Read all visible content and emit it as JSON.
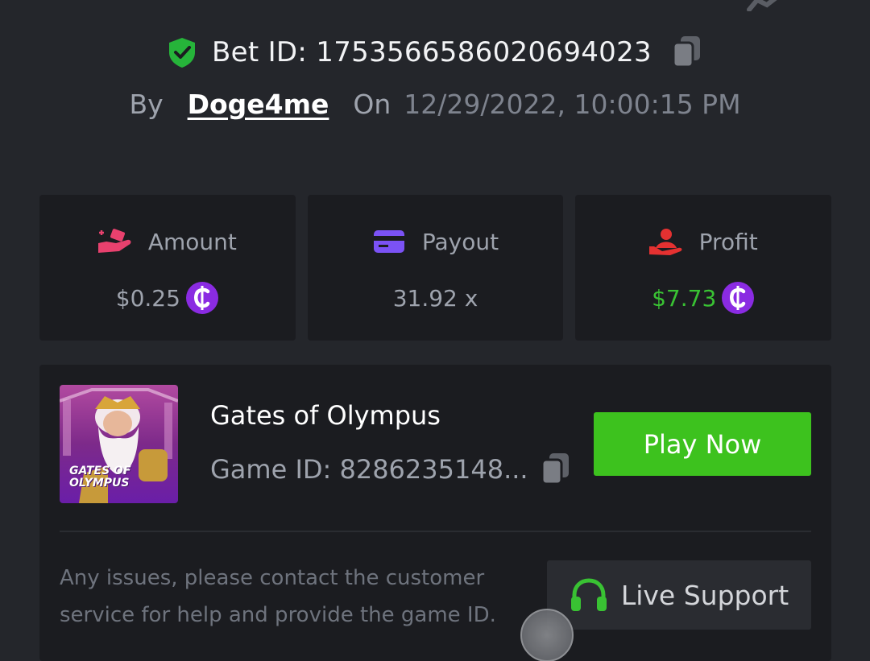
{
  "bet": {
    "id_label": "Bet ID: 1753566586020694023",
    "by_label": "By",
    "username": "Doge4me",
    "on_label": "On",
    "datetime": "12/29/2022, 10:00:15 PM"
  },
  "stats": [
    {
      "label": "Amount",
      "value": "$0.25",
      "icon": "money-hand-icon",
      "color": "#e8416e"
    },
    {
      "label": "Payout",
      "value": "31.92 x",
      "icon": "credit-card-icon",
      "color": "#7b52f5"
    },
    {
      "label": "Profit",
      "value": "$7.73",
      "icon": "profit-hand-icon",
      "color": "#e53131"
    }
  ],
  "game": {
    "name": "Gates of Olympus",
    "id_label": "Game ID: 8286235148...",
    "thumb_text_line1": "GATES OF",
    "thumb_text_line2": "OLYMPUS",
    "play_label": "Play Now"
  },
  "help": {
    "text": "Any issues, please contact the customer service for help and provide the game ID.",
    "support_label": "Live Support"
  },
  "colors": {
    "background": "#24262b",
    "card": "#1b1c20",
    "accent_green": "#3dc21e",
    "profit_green": "#39c233",
    "coin_purple": "#8a2be2"
  }
}
